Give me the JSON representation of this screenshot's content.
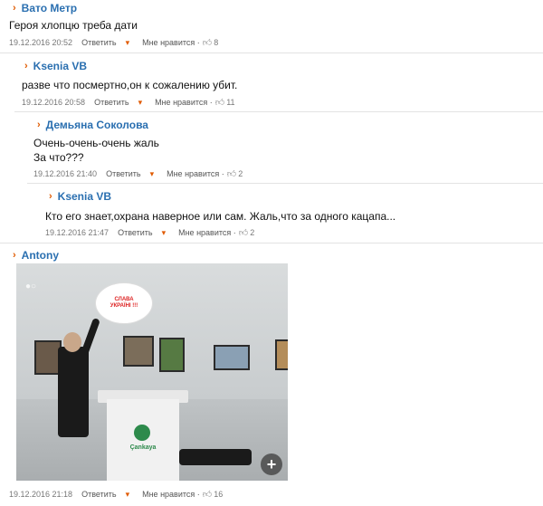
{
  "comments": [
    {
      "author": "Вато Метр",
      "text": "Героя хлопцю треба дати",
      "date": "19.12.2016 20:52",
      "reply": "Ответить",
      "like": "Мне нравится ·",
      "likes": "8"
    },
    {
      "author": "Ksenia VB",
      "text": "разве что посмертно,он к сожалению убит.",
      "date": "19.12.2016 20:58",
      "reply": "Ответить",
      "like": "Мне нравится ·",
      "likes": "11"
    },
    {
      "author": "Демьяна Соколова",
      "text1": "Очень-очень-очень жаль",
      "text2": "За что???",
      "date": "19.12.2016 21:40",
      "reply": "Ответить",
      "like": "Мне нравится ·",
      "likes": "2"
    },
    {
      "author": "Ksenia VB",
      "text": "Кто его знает,охрана наверное или сам. Жаль,что за одного кацапа...",
      "date": "19.12.2016 21:47",
      "reply": "Ответить",
      "like": "Мне нравится ·",
      "likes": "2"
    },
    {
      "author": "Antony",
      "date": "19.12.2016 21:18",
      "reply": "Ответить",
      "like": "Мне нравится ·",
      "likes": "16"
    }
  ],
  "image": {
    "bubble_line1": "СЛАВА",
    "bubble_line2": "УКРАЇНІ !!!",
    "podium_logo": "Çankaya",
    "zoom_symbol": "+"
  },
  "icons": {
    "chevron": "›",
    "caret": "▾",
    "thumb": "👍"
  }
}
